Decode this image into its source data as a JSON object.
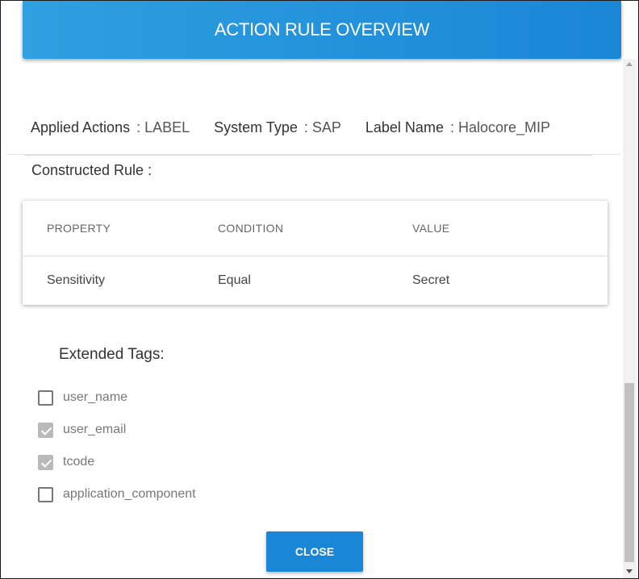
{
  "dialog": {
    "title": "ACTION RULE OVERVIEW",
    "accent_color": "#1a86d6"
  },
  "summary": {
    "applied_actions_label": "Applied Actions",
    "applied_actions_value": ": LABEL",
    "system_type_label": "System Type",
    "system_type_value": ": SAP",
    "label_name_label": "Label Name",
    "label_name_value": ": Halocore_MIP"
  },
  "constructed_rule": {
    "title": "Constructed Rule :",
    "headers": [
      "PROPERTY",
      "CONDITION",
      "VALUE"
    ],
    "rows": [
      [
        "Sensitivity",
        "Equal",
        "Secret"
      ]
    ]
  },
  "extended_tags": {
    "title": "Extended Tags:",
    "items": [
      {
        "label": "user_name",
        "checked": false
      },
      {
        "label": "user_email",
        "checked": true
      },
      {
        "label": "tcode",
        "checked": true
      },
      {
        "label": "application_component",
        "checked": false
      }
    ]
  },
  "footer": {
    "close_label": "CLOSE"
  }
}
